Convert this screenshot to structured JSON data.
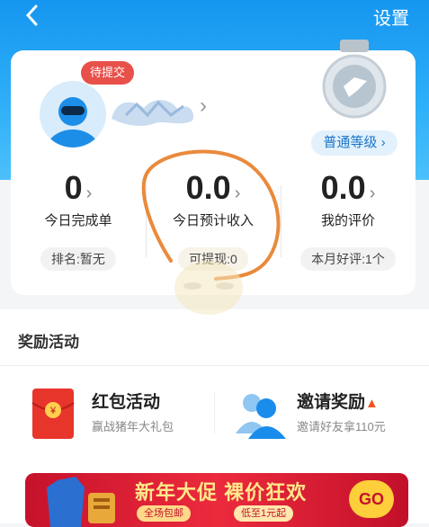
{
  "header": {
    "settings_label": "设置"
  },
  "profile": {
    "pending_badge": "待提交",
    "level_label": "普通等级"
  },
  "stats": [
    {
      "value": "0",
      "label": "今日完成单",
      "sub": "排名:暂无"
    },
    {
      "value": "0.0",
      "label": "今日预计收入",
      "sub": "可提现:0"
    },
    {
      "value": "0.0",
      "label": "我的评价",
      "sub": "本月好评:1个"
    }
  ],
  "rewards": {
    "title": "奖励活动",
    "items": [
      {
        "title": "红包活动",
        "subtitle": "赢战猪年大礼包"
      },
      {
        "title": "邀请奖励",
        "subtitle": "邀请好友拿110元"
      }
    ]
  },
  "banner": {
    "title": "新年大促 裸价狂欢",
    "tag1": "全场包邮",
    "tag2": "低至1元起",
    "go": "GO"
  },
  "colors": {
    "header": "#1596f0",
    "accent": "#1a75c9",
    "badge": "#e8504a",
    "annotation": "#e98a3c"
  }
}
